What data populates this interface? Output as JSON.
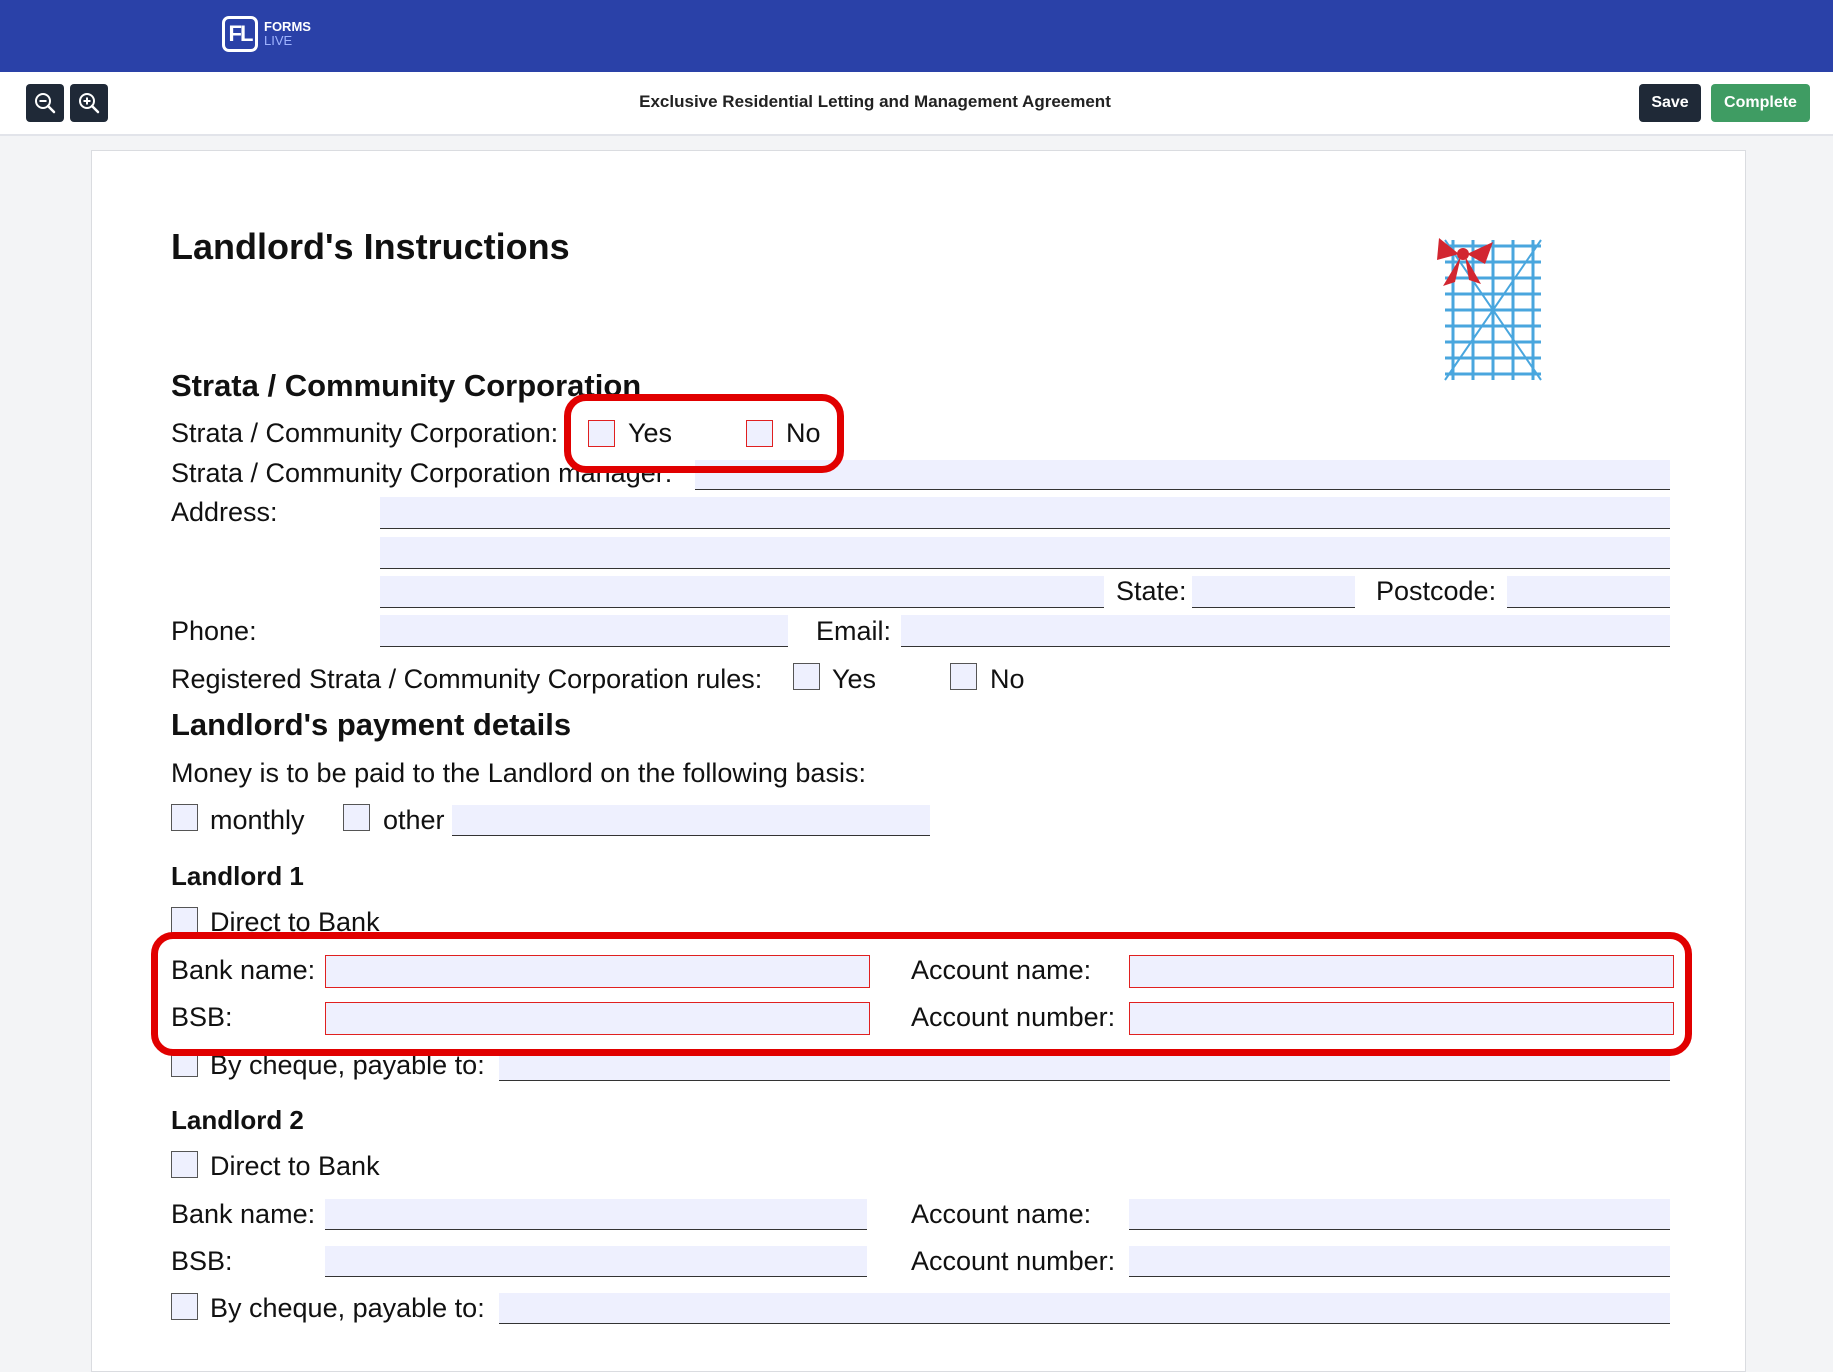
{
  "app": {
    "logo_line1": "FORMS",
    "logo_line2": "LIVE",
    "logo_mark": "FL"
  },
  "toolbar": {
    "title": "Exclusive Residential Letting and Management Agreement",
    "save_label": "Save",
    "complete_label": "Complete",
    "zoom_out_icon": "zoom-out-icon",
    "zoom_in_icon": "zoom-in-icon"
  },
  "form": {
    "title": "Landlord's Instructions",
    "strata": {
      "heading": "Strata / Community Corporation",
      "question_label": "Strata / Community Corporation:",
      "yes_label": "Yes",
      "no_label": "No",
      "manager_label": "Strata / Community Corporation manager:",
      "address_label": "Address:",
      "state_label": "State:",
      "postcode_label": "Postcode:",
      "phone_label": "Phone:",
      "email_label": "Email:",
      "rules_label": "Registered Strata / Community Corporation rules:",
      "rules_yes": "Yes",
      "rules_no": "No"
    },
    "payment": {
      "heading": "Landlord's payment details",
      "basis_text": "Money is to be paid to the Landlord on the following basis:",
      "monthly_label": "monthly",
      "other_label": "other"
    },
    "landlord1": {
      "heading": "Landlord 1",
      "direct_label": "Direct to Bank",
      "bank_name_label": "Bank name:",
      "account_name_label": "Account name:",
      "bsb_label": "BSB:",
      "account_number_label": "Account number:",
      "cheque_label": "By cheque, payable to:"
    },
    "landlord2": {
      "heading": "Landlord 2",
      "direct_label": "Direct to Bank",
      "bank_name_label": "Bank name:",
      "account_name_label": "Account name:",
      "bsb_label": "BSB:",
      "account_number_label": "Account number:",
      "cheque_label": "By cheque, payable to:"
    }
  },
  "colors": {
    "header": "#2a41a8",
    "annotation": "#e10000",
    "field_fill": "#eef0fe",
    "complete": "#3f9c63"
  }
}
